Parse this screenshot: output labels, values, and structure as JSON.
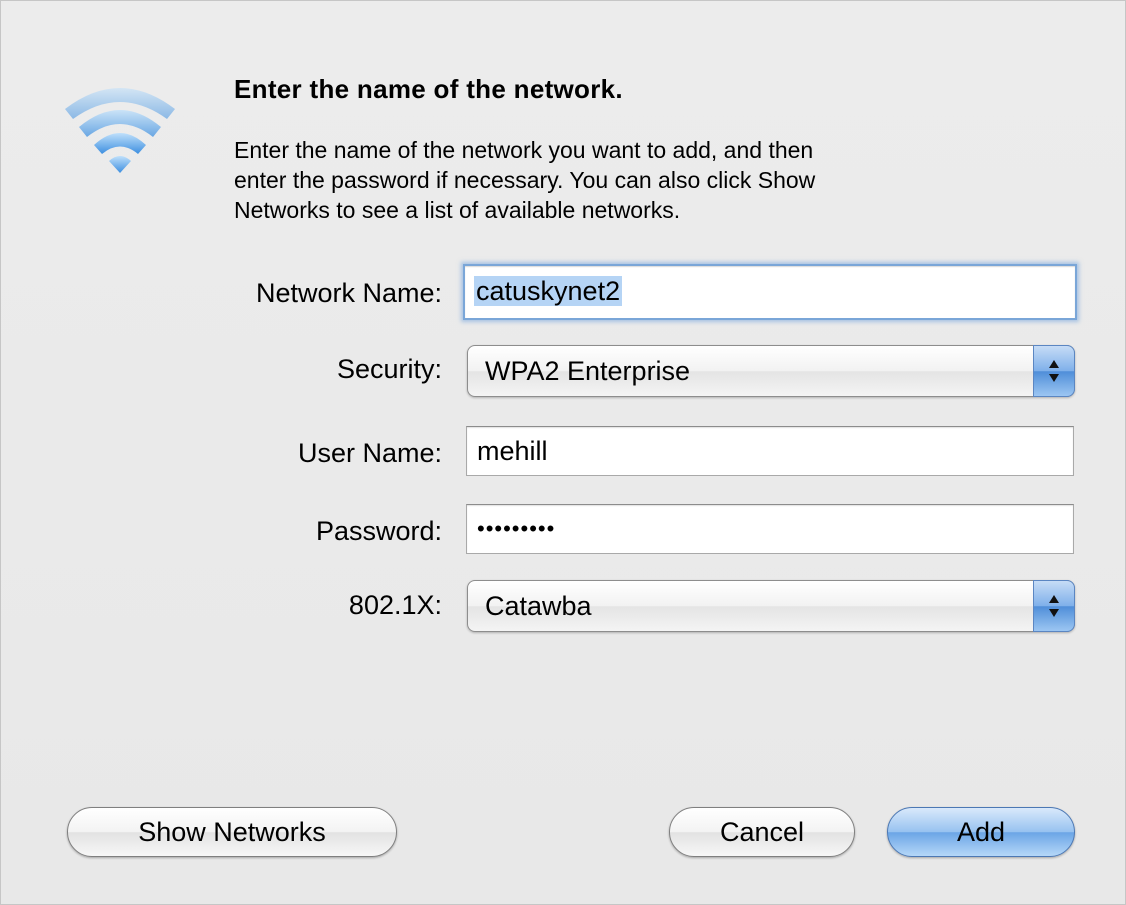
{
  "dialog": {
    "heading": "Enter the name of the network.",
    "description_lines": [
      "Enter the name of the network you want to add, and then",
      "enter the password if necessary. You can also click Show",
      "Networks to see a list of available networks."
    ]
  },
  "form": {
    "network_name": {
      "label": "Network Name:",
      "value": "catuskynet2"
    },
    "security": {
      "label": "Security:",
      "value": "WPA2 Enterprise"
    },
    "user_name": {
      "label": "User Name:",
      "value": "mehill"
    },
    "password": {
      "label": "Password:",
      "value": "•••••••••"
    },
    "dot1x": {
      "label": "802.1X:",
      "value": "Catawba"
    }
  },
  "buttons": {
    "show_networks": "Show Networks",
    "cancel": "Cancel",
    "add": "Add"
  },
  "icons": {
    "wifi": "wifi-icon",
    "popup_arrows": "updown-arrows-icon"
  },
  "colors": {
    "accent": "#6ba5e6",
    "selection": "#b5d4f5",
    "wifi_blue": "#4d9be6"
  }
}
